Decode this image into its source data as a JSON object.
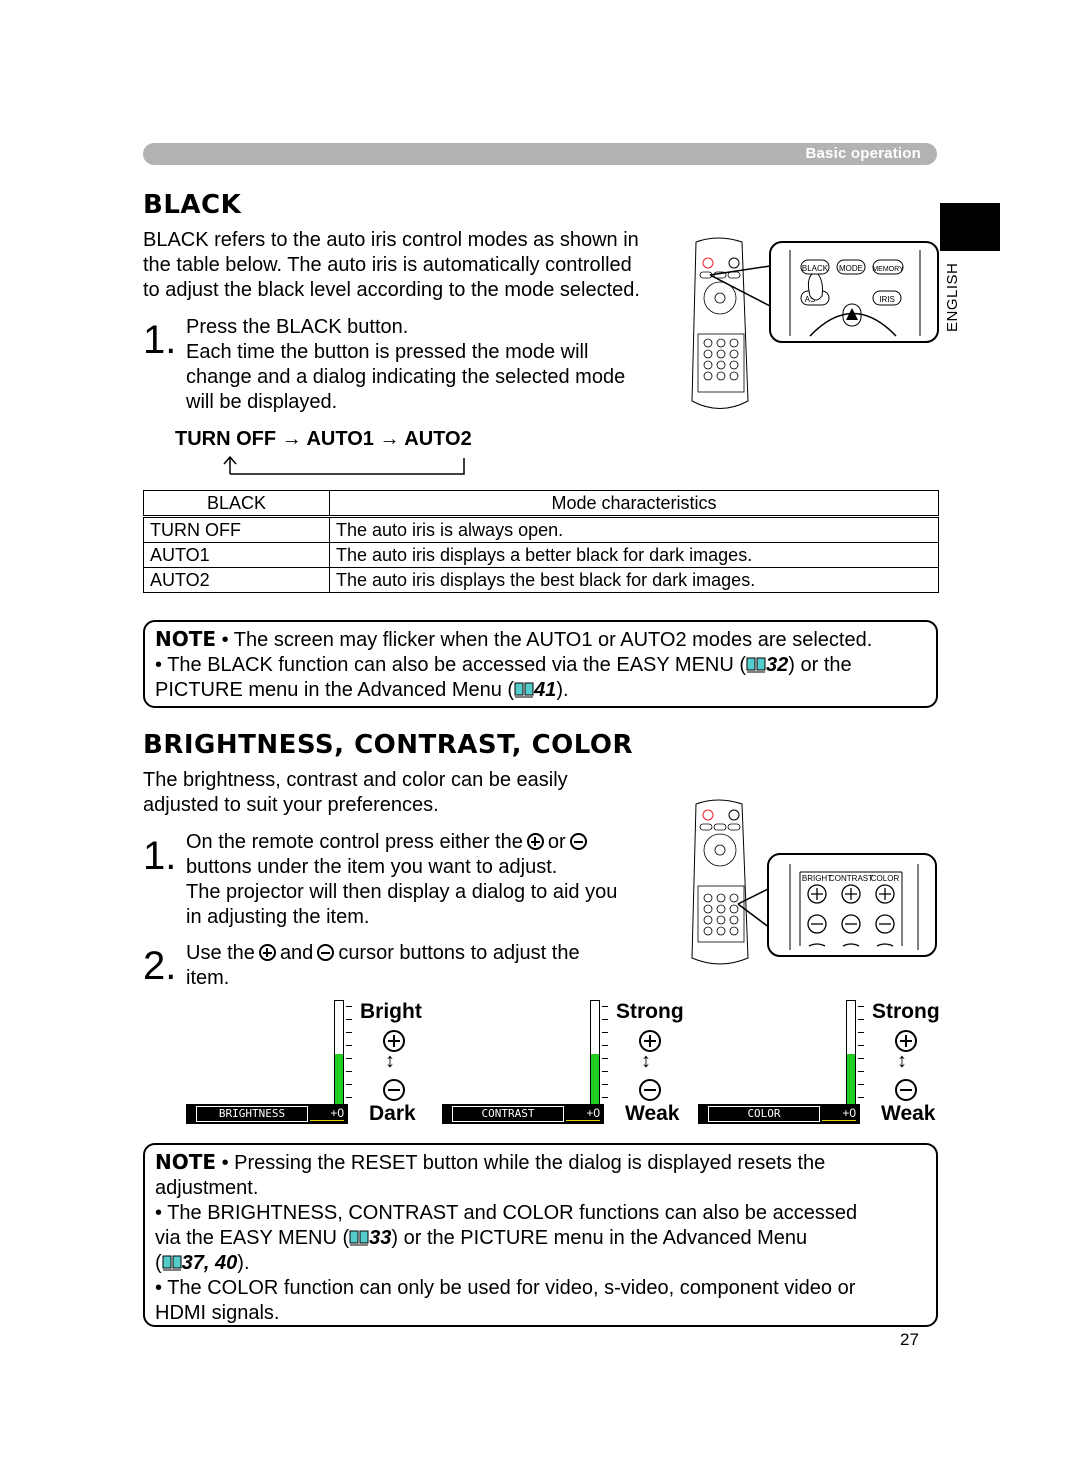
{
  "header": {
    "section_label": "Basic operation",
    "language_tab": "ENGLISH"
  },
  "black": {
    "title": "BLACK",
    "intro": [
      "BLACK refers to the auto iris control modes as shown in",
      "the table below. The auto iris is automatically controlled",
      "to adjust the black level according to the mode selected."
    ],
    "step1": {
      "number": "1.",
      "lines": [
        "Press the BLACK button.",
        "Each time the button is pressed the mode will",
        "change and a dialog indicating the selected mode",
        "will be displayed."
      ]
    },
    "cycle": [
      "TURN OFF",
      "AUTO1",
      "AUTO2"
    ],
    "cycle_arrow": "→",
    "remote_callout": {
      "buttons": [
        "BLACK",
        "MODE",
        "MEMORY",
        "ASPECT",
        "IRIS"
      ]
    },
    "table": {
      "headers": [
        "BLACK",
        "Mode characteristics"
      ],
      "rows": [
        [
          "TURN OFF",
          "The auto iris is always open."
        ],
        [
          "AUTO1",
          "The auto iris displays a better black for dark images."
        ],
        [
          "AUTO2",
          "The auto iris displays the best black for dark images."
        ]
      ]
    },
    "note": {
      "label": "NOTE",
      "line1": "• The screen may flicker when the AUTO1 or AUTO2 modes are selected.",
      "line2_pre": "• The BLACK function can also be accessed via the EASY MENU (",
      "line2_ref": "32",
      "line2_post": ") or the",
      "line3_pre": "PICTURE menu in the Advanced Menu (",
      "line3_ref": "41",
      "line3_post": ")."
    }
  },
  "bcc": {
    "title": "BRIGHTNESS, CONTRAST, COLOR",
    "intro": [
      "The brightness, contrast and color can be easily",
      "adjusted to suit your preferences."
    ],
    "step1": {
      "number": "1.",
      "line1_pre": "On the remote control press either the",
      "line1_mid": "or",
      "line2": "buttons under the item you want to adjust.",
      "line3": "The projector will then display a dialog to aid you",
      "line4": "in adjusting the item."
    },
    "step2": {
      "number": "2.",
      "pre": "Use the",
      "mid": "and",
      "post": "cursor buttons to adjust the",
      "line2": "item."
    },
    "remote_callout": {
      "labels": [
        "BRIGHT",
        "CONTRAST",
        "COLOR"
      ]
    },
    "gauges": [
      {
        "osd_label": "BRIGHTNESS",
        "value": "+0",
        "level": 0.5,
        "top_label": "Bright",
        "bottom_label": "Dark"
      },
      {
        "osd_label": "CONTRAST",
        "value": "+0",
        "level": 0.5,
        "top_label": "Strong",
        "bottom_label": "Weak"
      },
      {
        "osd_label": "COLOR",
        "value": "+0",
        "level": 0.5,
        "top_label": "Strong",
        "bottom_label": "Weak"
      }
    ],
    "note": {
      "label": "NOTE",
      "l1": "• Pressing the RESET button while the dialog is displayed resets the",
      "l2": "adjustment.",
      "l3": "• The BRIGHTNESS, CONTRAST and COLOR functions can also be accessed",
      "l4_pre": "via the EASY MENU (",
      "l4_ref": "33",
      "l4_post": ") or the PICTURE menu in the Advanced Menu",
      "l5_pre": "(",
      "l5_ref": "37, 40",
      "l5_post": ").",
      "l6": "• The COLOR function can only be used for video, s-video, component video or",
      "l7": "HDMI signals."
    }
  },
  "page_number": "27"
}
